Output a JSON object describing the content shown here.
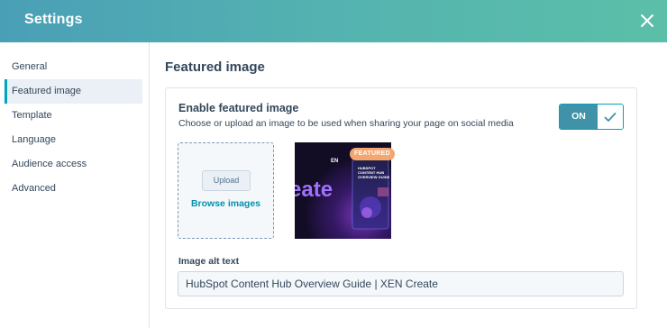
{
  "header": {
    "title": "Settings",
    "close_icon": "close-icon"
  },
  "sidebar": {
    "items": [
      {
        "label": "General",
        "active": false
      },
      {
        "label": "Featured image",
        "active": true
      },
      {
        "label": "Template",
        "active": false
      },
      {
        "label": "Language",
        "active": false
      },
      {
        "label": "Audience access",
        "active": false
      },
      {
        "label": "Advanced",
        "active": false
      }
    ]
  },
  "main": {
    "title": "Featured image",
    "enable": {
      "title": "Enable featured image",
      "description": "Choose or upload an image to be used when sharing your page on social media",
      "toggle_label": "ON",
      "toggle_state": true,
      "check_icon": "check-icon"
    },
    "upload": {
      "button_label": "Upload",
      "browse_label": "Browse images"
    },
    "thumbnail": {
      "badge": "FEATURED",
      "text_top": "HUBSPOT CONTENT HUB OVERVIEW GUIDE",
      "text_large": "eate",
      "text_small": "EN"
    },
    "alt_text": {
      "label": "Image alt text",
      "value": "HubSpot Content Hub Overview Guide | XEN Create"
    }
  },
  "colors": {
    "header_gradient_start": "#4a9fb6",
    "header_gradient_end": "#5bbfa8",
    "accent": "#00a4bd",
    "toggle_on": "#3f92a8",
    "link": "#0091ae",
    "badge": "#f5a56e",
    "text": "#33475b"
  }
}
